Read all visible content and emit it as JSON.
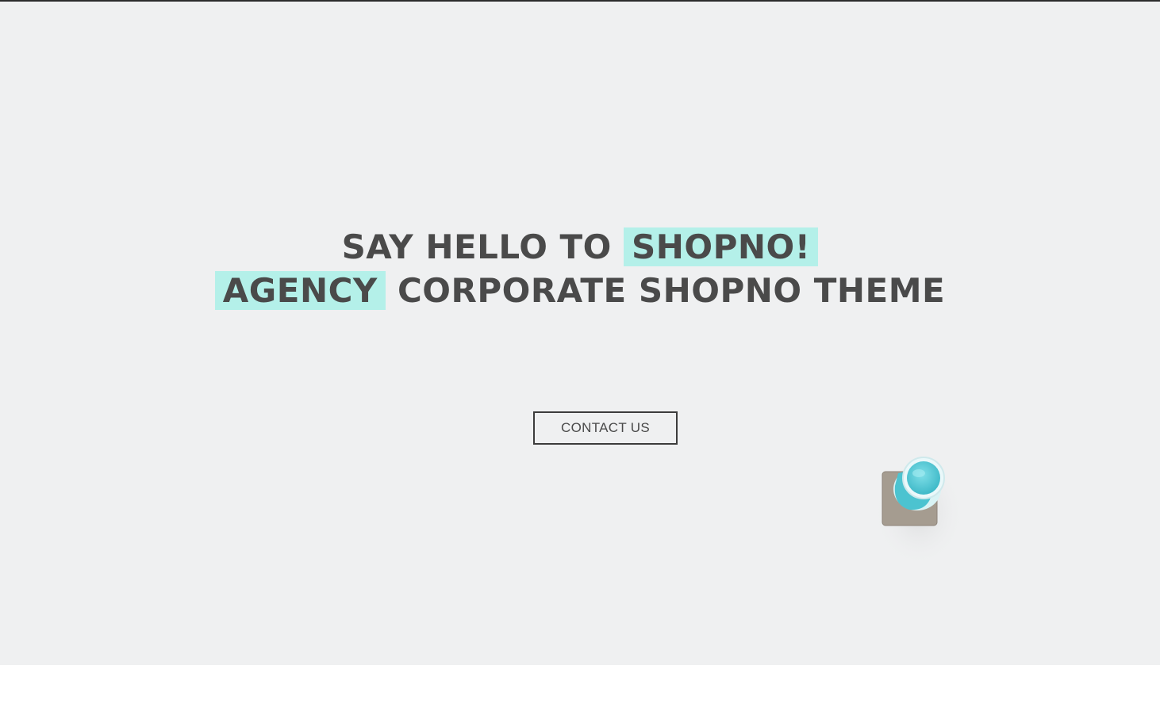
{
  "hero": {
    "headline_line1_part1": "SAY HELLO TO",
    "headline_line1_highlight": "SHOPNO!",
    "headline_line2_highlight": "AGENCY",
    "headline_line2_part2": "CORPORATE SHOPNO THEME",
    "cta_label": "CONTACT US"
  },
  "colors": {
    "background": "#eff0f1",
    "text": "#4a4a4a",
    "highlight": "#b4f0e9",
    "cup": "#5fd0dc"
  },
  "decoration": {
    "icon": "coffee-cup-on-coaster-image"
  }
}
